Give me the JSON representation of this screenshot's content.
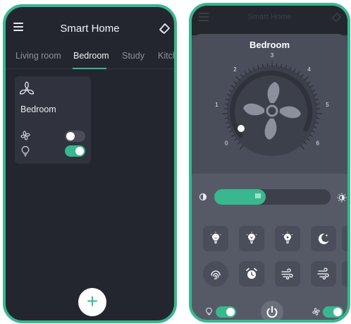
{
  "screen_home": {
    "title": "Smart Home",
    "tabs": [
      {
        "label": "Living room",
        "active": false
      },
      {
        "label": "Bedroom",
        "active": true
      },
      {
        "label": "Study",
        "active": false
      },
      {
        "label": "Kitch",
        "active": false
      }
    ],
    "room_card": {
      "name": "Bedroom",
      "fan_on": false,
      "light_on": true
    },
    "fab_label": "+"
  },
  "screen_fan": {
    "room": "Bedroom",
    "speed_scale": [
      "0",
      "1",
      "2",
      "3",
      "4",
      "5",
      "6"
    ],
    "current_speed": 0,
    "brightness_fraction": 0.44,
    "grip_label": "III",
    "footer": {
      "light_on": true,
      "fan_on": true
    }
  },
  "colors": {
    "accent": "#39b78e",
    "dark_bg": "#24262f",
    "card_bg": "#30333d",
    "panel_bg": "#4a4e5b"
  },
  "icons": [
    "menu-icon",
    "eraser-icon",
    "fan-icon",
    "bulb-icon",
    "moon-icon",
    "alarm-icon",
    "wind-icon",
    "power-icon",
    "brightness-icon"
  ]
}
